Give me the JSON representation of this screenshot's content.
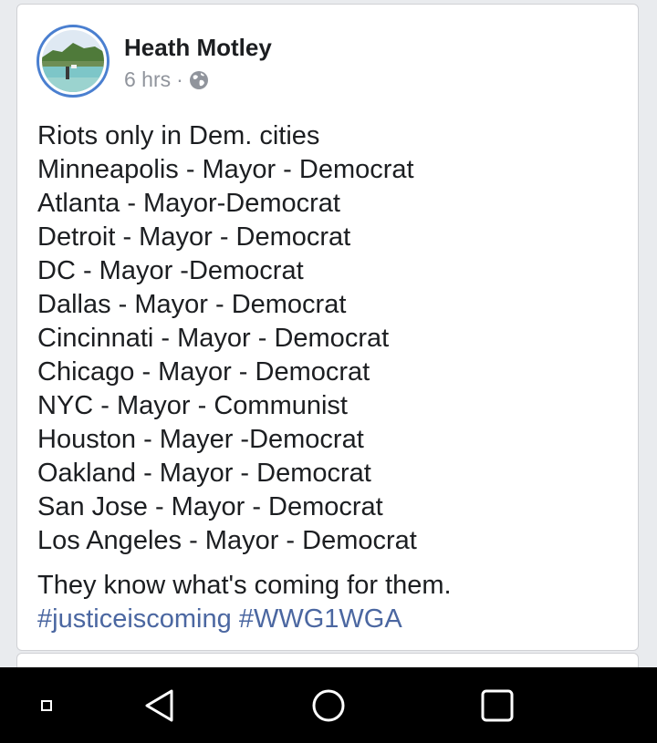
{
  "post": {
    "author": "Heath Motley",
    "timestamp": "6 hrs",
    "separator": "·",
    "privacy_icon": "globe-icon",
    "lines": [
      "Riots only in Dem. cities",
      "Minneapolis - Mayor - Democrat",
      "Atlanta - Mayor-Democrat",
      "Detroit - Mayor - Democrat",
      "DC - Mayor -Democrat",
      "Dallas - Mayor - Democrat",
      "Cincinnati - Mayor - Democrat",
      "Chicago - Mayor - Democrat",
      "NYC - Mayor - Communist",
      "Houston - Mayer -Democrat",
      "Oakland - Mayor - Democrat",
      "San Jose - Mayor - Democrat",
      "Los Angeles - Mayor - Democrat"
    ],
    "closing_line": "They know what's coming for them.",
    "hashtags": [
      "#justiceiscoming",
      "#WWG1WGA"
    ],
    "hashtag_color": "#4b67a1",
    "avatar_ring_color": "#4a7fd0"
  },
  "navbar": {
    "buttons": [
      "menu-square-icon",
      "back-triangle-icon",
      "home-circle-icon",
      "recents-square-icon"
    ]
  }
}
